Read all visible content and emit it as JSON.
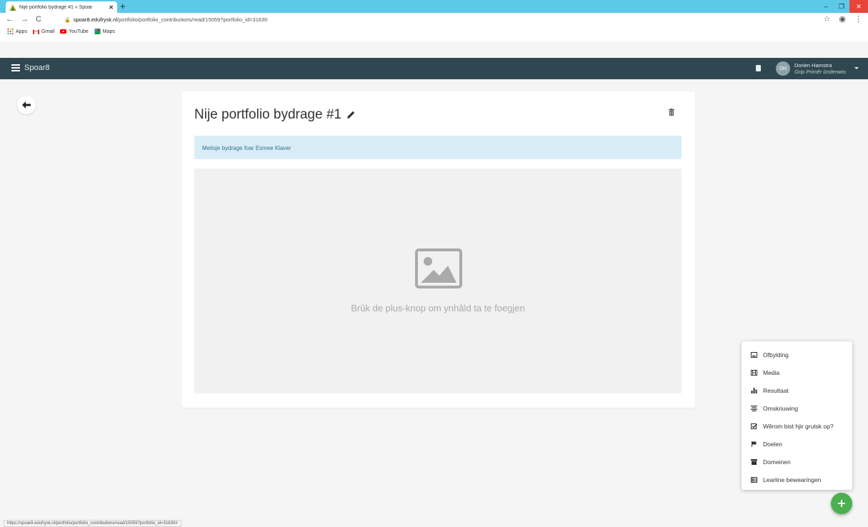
{
  "browser": {
    "tab_title": "Nije portfolio bydrage #1 « Spoar",
    "tab_close": "✕",
    "new_tab": "+",
    "url_host": "spoar8.edufrysk.nl",
    "url_path": "/portfolio/portfolio_contributions/read/15059?portfolio_id=31630",
    "bookmarks": [
      {
        "label": "Apps",
        "icon": "apps-grid-icon"
      },
      {
        "label": "Gmail",
        "icon": "gmail-icon"
      },
      {
        "label": "YouTube",
        "icon": "youtube-icon"
      },
      {
        "label": "Maps",
        "icon": "maps-icon"
      }
    ],
    "status_url": "https://spoar8.edufrysk.nl/portfolio/portfolio_contributions/read/15059?portfolio_id=31630#"
  },
  "app": {
    "brand": "Spoar8",
    "user_initials": "DH",
    "user_name": "Dorien Hamstra",
    "user_role": "Grip Primêr ûnderwiis"
  },
  "card": {
    "title": "Nije portfolio bydrage #1",
    "info_text": "Meitsje bydrage foar Esmee Klaver",
    "empty_text": "Brûk de plus-knop om ynhâld ta te foegjen"
  },
  "menu": {
    "items": [
      {
        "label": "Ofbylding",
        "icon": "image-icon"
      },
      {
        "label": "Media",
        "icon": "film-icon"
      },
      {
        "label": "Resultaat",
        "icon": "bar-chart-icon"
      },
      {
        "label": "Omskriuwing",
        "icon": "align-center-icon"
      },
      {
        "label": "Wêrom bist hjir grutsk op?",
        "icon": "check-square-icon"
      },
      {
        "label": "Doelen",
        "icon": "flag-icon"
      },
      {
        "label": "Domeinen",
        "icon": "archive-icon"
      },
      {
        "label": "Learline bewearingen",
        "icon": "list-icon"
      }
    ]
  },
  "colors": {
    "chrome_tabbar": "#5cc9e8",
    "appbar": "#2f4750",
    "info_bg": "#d9edf7",
    "info_text": "#31708f",
    "fab": "#4caf50"
  }
}
